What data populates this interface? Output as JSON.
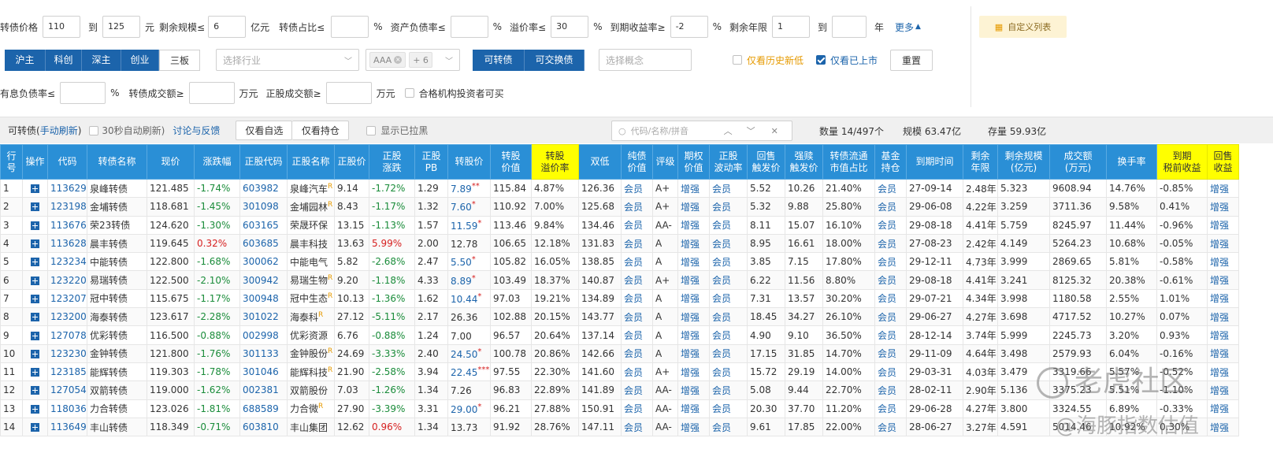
{
  "filters": {
    "row1": {
      "price_label": "转债价格",
      "price_from": "110",
      "to": "到",
      "price_to": "125",
      "price_unit": "元",
      "size_label": "剩余规模≤",
      "size_value": "6",
      "size_unit": "亿元",
      "ratio_label": "转债占比≤",
      "ratio_unit": "%",
      "debt_label": "资产负债率≤",
      "debt_unit": "%",
      "premium_label": "溢价率≤",
      "premium_value": "30",
      "premium_unit": "%",
      "ytm_label": "到期收益率≥",
      "ytm_value": "-2",
      "ytm_unit": "%",
      "years_label": "剩余年限",
      "years_from": "1",
      "years_to_label": "到",
      "years_unit": "年",
      "more_label": "更多"
    },
    "row2": {
      "exchanges": [
        "沪主",
        "科创",
        "深主",
        "创业",
        "三板"
      ],
      "industry_placeholder": "选择行业",
      "rating_tag": "AAA",
      "rating_more": "+ 6",
      "convert_tabs": [
        "可转债",
        "可交换债"
      ],
      "concept_placeholder": "选择概念",
      "history_low_label": "仅看历史新低",
      "listed_label": "仅看已上市",
      "reset_label": "重置"
    },
    "row3": {
      "interest_debt_label": "有息负债率≤",
      "interest_debt_unit": "%",
      "cb_volume_label": "转债成交额≥",
      "cb_volume_unit": "万元",
      "stock_volume_label": "正股成交额≥",
      "stock_volume_unit": "万元",
      "qualified_label": "合格机构投资者可买"
    },
    "custom_list_label": "自定义列表"
  },
  "toolbar": {
    "title": "可转债(",
    "manual_refresh": "手动刷新",
    "title_close": ")",
    "auto_refresh_label": "30秒自动刷新)",
    "feedback_link": "讨论与反馈",
    "self_select": "仅看自选",
    "holdings": "仅看持仓",
    "show_blacklist": "显示已拉黑",
    "search_placeholder": "代码/名称/拼音",
    "count": "数量 14/497个",
    "scale": "规模 63.47亿",
    "stock": "存量 59.93亿"
  },
  "table": {
    "headers": [
      "行号",
      "操作",
      "代码",
      "转债名称",
      "现价",
      "涨跌幅",
      "正股代码",
      "正股名称",
      "正股价",
      "正股\n涨跌",
      "正股\nPB",
      "转股价",
      "转股\n价值",
      "转股\n溢价率",
      "双低",
      "纯债\n价值",
      "评级",
      "期权\n价值",
      "正股\n波动率",
      "回售\n触发价",
      "强赎\n触发价",
      "转债流通\n市值占比",
      "基金\n持仓",
      "到期时间",
      "剩余\n年限",
      "剩余规模\n(亿元)",
      "成交额\n(万元)",
      "换手率",
      "到期\n税前收益",
      "回售\n收益"
    ],
    "rows": [
      {
        "no": "1",
        "code": "113629",
        "name": "泉峰转债",
        "price": "121.485",
        "chg": "-1.74%",
        "scode": "603982",
        "sname": "泉峰汽车",
        "r": "R",
        "sprice": "9.14",
        "schg": "-1.72%",
        "pb": "1.29",
        "cprice": "7.89",
        "star": "**",
        "cvalue": "115.84",
        "prem": "4.87%",
        "dlow": "126.36",
        "bond": "会员",
        "rating": "A+",
        "opt": "增强",
        "vol": "会员",
        "put": "5.52",
        "call": "10.26",
        "mcap": "21.40%",
        "fund": "会员",
        "due": "27-09-14",
        "yrs": "2.48年",
        "size": "5.323",
        "amt": "9608.94",
        "turn": "14.76%",
        "ytm": "-0.85%",
        "putret": "增强"
      },
      {
        "no": "2",
        "code": "123198",
        "name": "金埔转债",
        "price": "118.681",
        "chg": "-1.45%",
        "scode": "301098",
        "sname": "金埔园林",
        "r": "R",
        "sprice": "8.43",
        "schg": "-1.17%",
        "pb": "1.32",
        "cprice": "7.60",
        "star": "*",
        "cvalue": "110.92",
        "prem": "7.00%",
        "dlow": "125.68",
        "bond": "会员",
        "rating": "A+",
        "opt": "增强",
        "vol": "会员",
        "put": "5.32",
        "call": "9.88",
        "mcap": "25.80%",
        "fund": "会员",
        "due": "29-06-08",
        "yrs": "4.22年",
        "size": "3.259",
        "amt": "3711.36",
        "turn": "9.58%",
        "ytm": "0.41%",
        "putret": "增强"
      },
      {
        "no": "3",
        "code": "113676",
        "name": "荣23转债",
        "price": "124.620",
        "chg": "-1.30%",
        "scode": "603165",
        "sname": "荣晟环保",
        "r": "",
        "sprice": "13.15",
        "schg": "-1.13%",
        "pb": "1.57",
        "cprice": "11.59",
        "star": "*",
        "cvalue": "113.46",
        "prem": "9.84%",
        "dlow": "134.46",
        "bond": "会员",
        "rating": "AA-",
        "opt": "增强",
        "vol": "会员",
        "put": "8.11",
        "call": "15.07",
        "mcap": "16.10%",
        "fund": "会员",
        "due": "29-08-18",
        "yrs": "4.41年",
        "size": "5.759",
        "amt": "8245.97",
        "turn": "11.44%",
        "ytm": "-0.96%",
        "putret": "增强"
      },
      {
        "no": "4",
        "code": "113628",
        "name": "晨丰转债",
        "price": "119.645",
        "chg": "0.32%",
        "scode": "603685",
        "sname": "晨丰科技",
        "r": "",
        "sprice": "13.63",
        "schg": "5.99%",
        "pb": "2.00",
        "cprice": "12.78",
        "star": "",
        "cvalue": "106.65",
        "prem": "12.18%",
        "dlow": "131.83",
        "bond": "会员",
        "rating": "A",
        "opt": "增强",
        "vol": "会员",
        "put": "8.95",
        "call": "16.61",
        "mcap": "18.00%",
        "fund": "会员",
        "due": "27-08-23",
        "yrs": "2.42年",
        "size": "4.149",
        "amt": "5264.23",
        "turn": "10.68%",
        "ytm": "-0.05%",
        "putret": "增强"
      },
      {
        "no": "5",
        "code": "123234",
        "name": "中能转债",
        "price": "122.800",
        "chg": "-1.68%",
        "scode": "300062",
        "sname": "中能电气",
        "r": "",
        "sprice": "5.82",
        "schg": "-2.68%",
        "pb": "2.47",
        "cprice": "5.50",
        "star": "*",
        "cvalue": "105.82",
        "prem": "16.05%",
        "dlow": "138.85",
        "bond": "会员",
        "rating": "A",
        "opt": "增强",
        "vol": "会员",
        "put": "3.85",
        "call": "7.15",
        "mcap": "17.80%",
        "fund": "会员",
        "due": "29-12-11",
        "yrs": "4.73年",
        "size": "3.999",
        "amt": "2869.65",
        "turn": "5.81%",
        "ytm": "-0.58%",
        "putret": "增强"
      },
      {
        "no": "6",
        "code": "123220",
        "name": "易瑞转债",
        "price": "122.500",
        "chg": "-2.10%",
        "scode": "300942",
        "sname": "易瑞生物",
        "r": "R",
        "sprice": "9.20",
        "schg": "-1.18%",
        "pb": "4.33",
        "cprice": "8.89",
        "star": "*",
        "cvalue": "103.49",
        "prem": "18.37%",
        "dlow": "140.87",
        "bond": "会员",
        "rating": "A+",
        "opt": "增强",
        "vol": "会员",
        "put": "6.22",
        "call": "11.56",
        "mcap": "8.80%",
        "fund": "会员",
        "due": "29-08-18",
        "yrs": "4.41年",
        "size": "3.241",
        "amt": "8125.32",
        "turn": "20.38%",
        "ytm": "-0.61%",
        "putret": "增强"
      },
      {
        "no": "7",
        "code": "123207",
        "name": "冠中转债",
        "price": "115.675",
        "chg": "-1.17%",
        "scode": "300948",
        "sname": "冠中生态",
        "r": "R",
        "sprice": "10.13",
        "schg": "-1.36%",
        "pb": "1.62",
        "cprice": "10.44",
        "star": "*",
        "cvalue": "97.03",
        "prem": "19.21%",
        "dlow": "134.89",
        "bond": "会员",
        "rating": "A",
        "opt": "增强",
        "vol": "会员",
        "put": "7.31",
        "call": "13.57",
        "mcap": "30.20%",
        "fund": "会员",
        "due": "29-07-21",
        "yrs": "4.34年",
        "size": "3.998",
        "amt": "1180.58",
        "turn": "2.55%",
        "ytm": "1.01%",
        "putret": "增强"
      },
      {
        "no": "8",
        "code": "123200",
        "name": "海泰转债",
        "price": "123.617",
        "chg": "-2.28%",
        "scode": "301022",
        "sname": "海泰科",
        "r": "R",
        "sprice": "27.12",
        "schg": "-5.11%",
        "pb": "2.17",
        "cprice": "26.36",
        "star": "",
        "cvalue": "102.88",
        "prem": "20.15%",
        "dlow": "143.77",
        "bond": "会员",
        "rating": "A",
        "opt": "增强",
        "vol": "会员",
        "put": "18.45",
        "call": "34.27",
        "mcap": "26.10%",
        "fund": "会员",
        "due": "29-06-27",
        "yrs": "4.27年",
        "size": "3.698",
        "amt": "4717.52",
        "turn": "10.27%",
        "ytm": "0.07%",
        "putret": "增强"
      },
      {
        "no": "9",
        "code": "127078",
        "name": "优彩转债",
        "price": "116.500",
        "chg": "-0.88%",
        "scode": "002998",
        "sname": "优彩资源",
        "r": "",
        "sprice": "6.76",
        "schg": "-0.88%",
        "pb": "1.24",
        "cprice": "7.00",
        "star": "",
        "cvalue": "96.57",
        "prem": "20.64%",
        "dlow": "137.14",
        "bond": "会员",
        "rating": "A",
        "opt": "增强",
        "vol": "会员",
        "put": "4.90",
        "call": "9.10",
        "mcap": "36.50%",
        "fund": "会员",
        "due": "28-12-14",
        "yrs": "3.74年",
        "size": "5.999",
        "amt": "2245.73",
        "turn": "3.20%",
        "ytm": "0.93%",
        "putret": "增强"
      },
      {
        "no": "10",
        "code": "123230",
        "name": "金钟转债",
        "price": "121.800",
        "chg": "-1.76%",
        "scode": "301133",
        "sname": "金钟股份",
        "r": "R",
        "sprice": "24.69",
        "schg": "-3.33%",
        "pb": "2.40",
        "cprice": "24.50",
        "star": "*",
        "cvalue": "100.78",
        "prem": "20.86%",
        "dlow": "142.66",
        "bond": "会员",
        "rating": "A",
        "opt": "增强",
        "vol": "会员",
        "put": "17.15",
        "call": "31.85",
        "mcap": "14.70%",
        "fund": "会员",
        "due": "29-11-09",
        "yrs": "4.64年",
        "size": "3.498",
        "amt": "2579.93",
        "turn": "6.04%",
        "ytm": "-0.16%",
        "putret": "增强"
      },
      {
        "no": "11",
        "code": "123185",
        "name": "能辉转债",
        "price": "119.303",
        "chg": "-1.78%",
        "scode": "301046",
        "sname": "能辉科技",
        "r": "R",
        "sprice": "21.90",
        "schg": "-2.58%",
        "pb": "3.94",
        "cprice": "22.45",
        "star": "***",
        "cvalue": "97.55",
        "prem": "22.30%",
        "dlow": "141.60",
        "bond": "会员",
        "rating": "A+",
        "opt": "增强",
        "vol": "会员",
        "put": "15.72",
        "call": "29.19",
        "mcap": "14.00%",
        "fund": "会员",
        "due": "29-03-31",
        "yrs": "4.03年",
        "size": "3.479",
        "amt": "3319.66",
        "turn": "5.57%",
        "ytm": "-0.52%",
        "putret": "增强"
      },
      {
        "no": "12",
        "code": "127054",
        "name": "双箭转债",
        "price": "119.000",
        "chg": "-1.62%",
        "scode": "002381",
        "sname": "双箭股份",
        "r": "",
        "sprice": "7.03",
        "schg": "-1.26%",
        "pb": "1.34",
        "cprice": "7.26",
        "star": "",
        "cvalue": "96.83",
        "prem": "22.89%",
        "dlow": "141.89",
        "bond": "会员",
        "rating": "AA-",
        "opt": "增强",
        "vol": "会员",
        "put": "5.08",
        "call": "9.44",
        "mcap": "22.70%",
        "fund": "会员",
        "due": "28-02-11",
        "yrs": "2.90年",
        "size": "5.136",
        "amt": "3375.23",
        "turn": "5.51%",
        "ytm": "-1.10%",
        "putret": "增强"
      },
      {
        "no": "13",
        "code": "118036",
        "name": "力合转债",
        "price": "123.026",
        "chg": "-1.81%",
        "scode": "688589",
        "sname": "力合微",
        "r": "R",
        "sprice": "27.90",
        "schg": "-3.39%",
        "pb": "3.31",
        "cprice": "29.00",
        "star": "*",
        "cvalue": "96.21",
        "prem": "27.88%",
        "dlow": "150.91",
        "bond": "会员",
        "rating": "AA-",
        "opt": "增强",
        "vol": "会员",
        "put": "20.30",
        "call": "37.70",
        "mcap": "11.20%",
        "fund": "会员",
        "due": "29-06-28",
        "yrs": "4.27年",
        "size": "3.800",
        "amt": "3324.55",
        "turn": "6.89%",
        "ytm": "-0.33%",
        "putret": "增强"
      },
      {
        "no": "14",
        "code": "113649",
        "name": "丰山转债",
        "price": "118.349",
        "chg": "-0.71%",
        "scode": "603810",
        "sname": "丰山集团",
        "r": "",
        "sprice": "12.62",
        "schg": "0.96%",
        "pb": "1.34",
        "cprice": "13.73",
        "star": "",
        "cvalue": "91.92",
        "prem": "28.76%",
        "dlow": "147.11",
        "bond": "会员",
        "rating": "AA-",
        "opt": "增强",
        "vol": "会员",
        "put": "9.61",
        "call": "17.85",
        "mcap": "22.00%",
        "fund": "会员",
        "due": "28-06-27",
        "yrs": "3.27年",
        "size": "4.591",
        "amt": "5014.46",
        "turn": "10.92%",
        "ytm": "0.30%",
        "putret": "增强"
      }
    ]
  },
  "watermark": {
    "logo": "老虎社区",
    "handle": "@海豚指数估值"
  },
  "colors": {
    "header_blue": "#2a8fd6",
    "highlight_yellow": "#ffff00",
    "up_red": "#d62020",
    "down_green": "#1a8c3a",
    "link_blue": "#1c64ab"
  }
}
